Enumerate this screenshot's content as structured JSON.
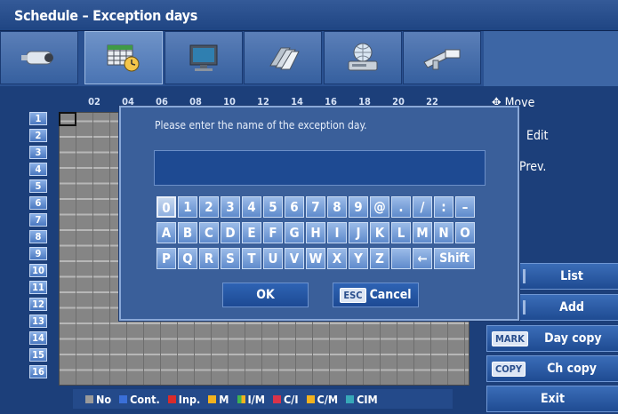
{
  "title": "Schedule – Exception days",
  "tabs": [
    {
      "icon": "camera-icon"
    },
    {
      "icon": "calendar-clock-icon",
      "active": true
    },
    {
      "icon": "monitor-icon"
    },
    {
      "icon": "disks-icon"
    },
    {
      "icon": "network-icon"
    },
    {
      "icon": "tools-icon"
    }
  ],
  "hours": [
    "02",
    "04",
    "06",
    "08",
    "10",
    "12",
    "14",
    "16",
    "18",
    "20",
    "22"
  ],
  "rows": [
    "1",
    "2",
    "3",
    "4",
    "5",
    "6",
    "7",
    "8",
    "9",
    "10",
    "11",
    "12",
    "13",
    "14",
    "15",
    "16"
  ],
  "legend": [
    {
      "label": "No",
      "color": "#9a9a9a"
    },
    {
      "label": "Cont.",
      "color": "#3a6fd8"
    },
    {
      "label": "Inp.",
      "color": "#d92b2b"
    },
    {
      "label": "M",
      "color": "#f2b21f"
    },
    {
      "label": "I/M",
      "color": "#3fb34f"
    },
    {
      "label": "C/I",
      "color": "#d9334a"
    },
    {
      "label": "C/M",
      "color": "#f2b21f"
    },
    {
      "label": "CIM",
      "color": "#37a8b8"
    }
  ],
  "right_panel": {
    "move": "Move",
    "edit": "Edit",
    "prev": "Prev.",
    "list": "List",
    "add": "Add",
    "day_copy": "Day copy",
    "day_copy_key": "MARK",
    "ch_copy": "Ch copy",
    "ch_copy_key": "COPY",
    "exit": "Exit"
  },
  "dialog": {
    "message": "Please enter the name of the exception day.",
    "input_value": "",
    "keys_row1": [
      "0",
      "1",
      "2",
      "3",
      "4",
      "5",
      "6",
      "7",
      "8",
      "9",
      "@",
      ".",
      "/",
      ":",
      "–"
    ],
    "keys_row2": [
      "A",
      "B",
      "C",
      "D",
      "E",
      "F",
      "G",
      "H",
      "I",
      "J",
      "K",
      "L",
      "M",
      "N",
      "O"
    ],
    "keys_row3": [
      "P",
      "Q",
      "R",
      "S",
      "T",
      "U",
      "V",
      "W",
      "X",
      "Y",
      "Z",
      " ",
      "←",
      "Shift"
    ],
    "ok": "OK",
    "cancel": "Cancel",
    "cancel_key": "ESC"
  }
}
